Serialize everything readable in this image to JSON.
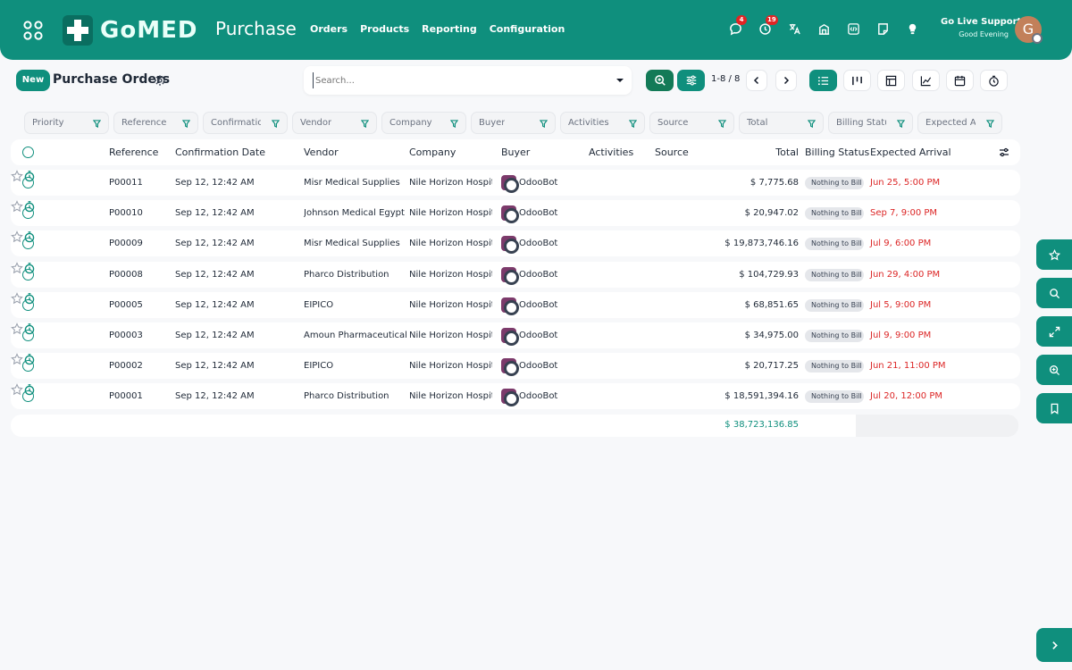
{
  "header": {
    "app_name": "Purchase",
    "logo_text": "GoMED",
    "nav": [
      "Orders",
      "Products",
      "Reporting",
      "Configuration"
    ],
    "messages_count": "4",
    "activities_count": "19",
    "user_name": "Go Live Support",
    "greeting": "Good Evening",
    "avatar_initial": "G",
    "brand_color": "#0f8f7d"
  },
  "control": {
    "new_label": "New",
    "title": "Purchase Orders",
    "search_placeholder": "Search...",
    "pager": "1-8 / 8"
  },
  "filters": [
    "Priority",
    "Reference",
    "Confirmatio",
    "Vendor",
    "Company",
    "Buyer",
    "Activities",
    "Source",
    "Total",
    "Billing Statu",
    "Expected A"
  ],
  "columns": {
    "reference": "Reference",
    "confirmation_date": "Confirmation Date",
    "vendor": "Vendor",
    "company": "Company",
    "buyer": "Buyer",
    "activities": "Activities",
    "source": "Source",
    "total": "Total",
    "billing_status": "Billing Status",
    "expected_arrival": "Expected Arrival"
  },
  "rows": [
    {
      "ref": "P00011",
      "date": "Sep 12, 12:42 AM",
      "vendor": "Misr Medical Supplies",
      "company": "Nile Horizon Hospital",
      "buyer": "OdooBot",
      "total": "$ 7,775.68",
      "billing": "Nothing to Bill",
      "arrival": "Jun 25, 5:00 PM"
    },
    {
      "ref": "P00010",
      "date": "Sep 12, 12:42 AM",
      "vendor": "Johnson Medical Egypt",
      "company": "Nile Horizon Hospital",
      "buyer": "OdooBot",
      "total": "$ 20,947.02",
      "billing": "Nothing to Bill",
      "arrival": "Sep 7, 9:00 PM"
    },
    {
      "ref": "P00009",
      "date": "Sep 12, 12:42 AM",
      "vendor": "Misr Medical Supplies",
      "company": "Nile Horizon Hospital",
      "buyer": "OdooBot",
      "total": "$ 19,873,746.16",
      "billing": "Nothing to Bill",
      "arrival": "Jul 9, 6:00 PM"
    },
    {
      "ref": "P00008",
      "date": "Sep 12, 12:42 AM",
      "vendor": "Pharco Distribution",
      "company": "Nile Horizon Hospital",
      "buyer": "OdooBot",
      "total": "$ 104,729.93",
      "billing": "Nothing to Bill",
      "arrival": "Jun 29, 4:00 PM"
    },
    {
      "ref": "P00005",
      "date": "Sep 12, 12:42 AM",
      "vendor": "EIPICO",
      "company": "Nile Horizon Hospital",
      "buyer": "OdooBot",
      "total": "$ 68,851.65",
      "billing": "Nothing to Bill",
      "arrival": "Jul 5, 9:00 PM"
    },
    {
      "ref": "P00003",
      "date": "Sep 12, 12:42 AM",
      "vendor": "Amoun Pharmaceutical",
      "company": "Nile Horizon Hospital",
      "buyer": "OdooBot",
      "total": "$ 34,975.00",
      "billing": "Nothing to Bill",
      "arrival": "Jul 9, 9:00 PM"
    },
    {
      "ref": "P00002",
      "date": "Sep 12, 12:42 AM",
      "vendor": "EIPICO",
      "company": "Nile Horizon Hospital",
      "buyer": "OdooBot",
      "total": "$ 20,717.25",
      "billing": "Nothing to Bill",
      "arrival": "Jun 21, 11:00 PM"
    },
    {
      "ref": "P00001",
      "date": "Sep 12, 12:42 AM",
      "vendor": "Pharco Distribution",
      "company": "Nile Horizon Hospital",
      "buyer": "OdooBot",
      "total": "$ 18,591,394.16",
      "billing": "Nothing to Bill",
      "arrival": "Jul 20, 12:00 PM"
    }
  ],
  "grand_total": "$ 38,723,136.85",
  "icons": {
    "top": [
      "apps-grid-icon",
      "chat-icon",
      "clock-icon",
      "translate-icon",
      "building-icon",
      "code-icon",
      "note-icon",
      "lightbulb-icon"
    ],
    "toolbar": [
      "zoom-search-icon",
      "sliders-icon",
      "chevron-left-icon",
      "chevron-right-icon",
      "list-view-icon",
      "kanban-view-icon",
      "pivot-view-icon",
      "graph-view-icon",
      "calendar-view-icon",
      "activity-view-icon"
    ],
    "side": [
      "star-icon",
      "search-icon",
      "expand-icon",
      "zoom-icon",
      "bookmark-icon",
      "chevron-right-icon"
    ]
  }
}
